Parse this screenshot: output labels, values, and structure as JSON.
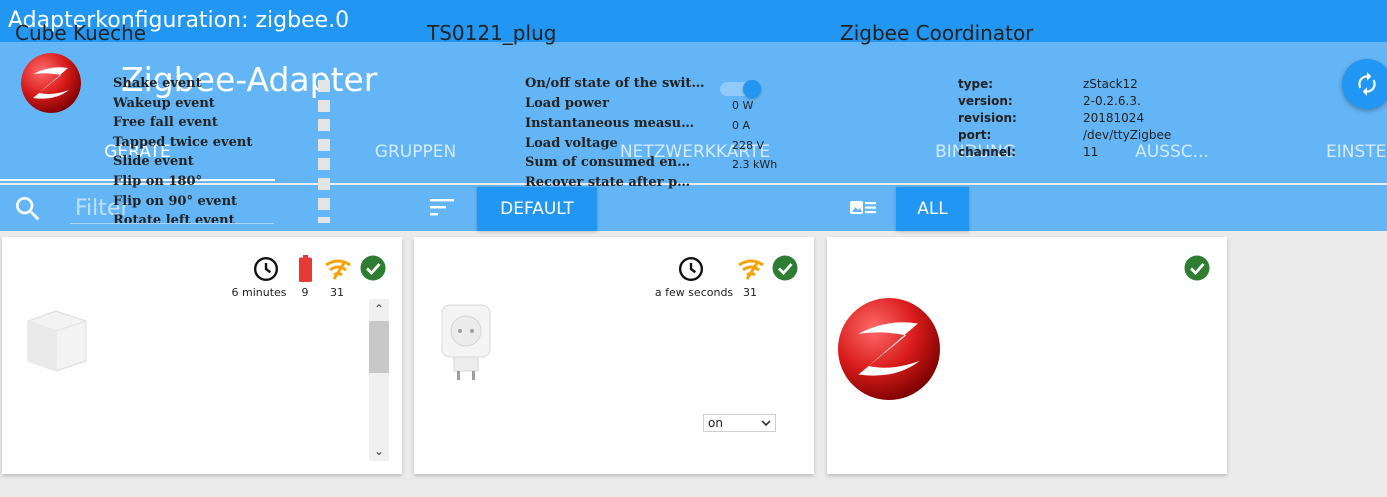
{
  "window": {
    "title": "Adapterkonfiguration: zigbee.0"
  },
  "header": {
    "app_title": "Zigbee-Adapter"
  },
  "tabs": [
    {
      "label": "GERÄTE"
    },
    {
      "label": "GRUPPEN"
    },
    {
      "label": "NETZWERKKARTE"
    },
    {
      "label": "BINDUNG"
    },
    {
      "label": "AUSSC..."
    },
    {
      "label": "EINSTEL"
    }
  ],
  "filter": {
    "placeholder": "Filter",
    "sort_button": "DEFAULT",
    "view_button": "ALL"
  },
  "colors": {
    "primary": "#2196f3",
    "light": "#64b5f6",
    "ok_green": "#2e7d32",
    "battery_red": "#e53935",
    "signal_orange": "#f6a20a",
    "zigbee_red": "#d81b1b"
  },
  "devices": [
    {
      "name": "Cube Kueche",
      "last_seen": "6 minutes",
      "battery": "9",
      "link_quality": "31",
      "events": [
        "Shake event",
        "Wakeup event",
        "Free fall event",
        "Tapped twice event",
        "Slide event",
        "Flip on 180°",
        "Flip on 90° event",
        "Rotate left event"
      ]
    },
    {
      "name": "TS0121_plug",
      "last_seen": "a few seconds",
      "link_quality": "31",
      "states": [
        {
          "label": "On/off state of the switch",
          "value": ""
        },
        {
          "label": "Load power",
          "value": "0 W"
        },
        {
          "label": "Instantaneous measured...",
          "value": "0 A"
        },
        {
          "label": "Load voltage",
          "value": "228 V"
        },
        {
          "label": "Sum of consumed energy",
          "value": "2.3 kWh"
        },
        {
          "label": "Recover state after powe...",
          "value": "on"
        }
      ]
    },
    {
      "name": "Zigbee Coordinator",
      "info": [
        {
          "key": "type:",
          "value": "zStack12"
        },
        {
          "key": "version:",
          "value": "2-0.2.6.3."
        },
        {
          "key": "revision:",
          "value": "20181024"
        },
        {
          "key": "port:",
          "value": "/dev/ttyZigbee"
        },
        {
          "key": "channel:",
          "value": "11"
        }
      ]
    }
  ]
}
